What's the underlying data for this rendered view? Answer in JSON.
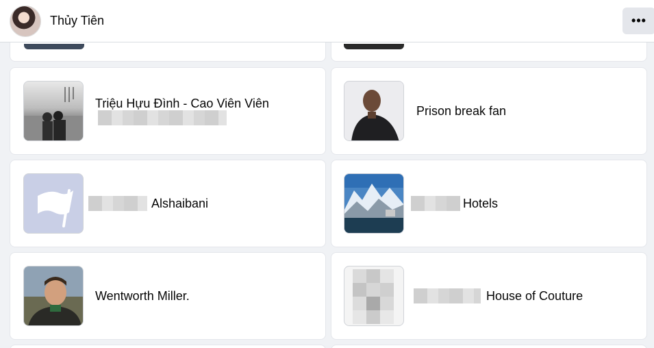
{
  "header": {
    "name": "Thủy Tiên",
    "more_label": "•••"
  },
  "cards": [
    {
      "name": "Triệu Hựu Đình - Cao Viên Viên",
      "thumb": "photo-couple"
    },
    {
      "name": "Prison break fan",
      "thumb": "photo-man-hoodie"
    },
    {
      "name": "Alshaibani",
      "thumb": "page-flag-icon"
    },
    {
      "name": "Hotels",
      "thumb": "photo-mountains"
    },
    {
      "name": "Wentworth Miller.",
      "thumb": "photo-man"
    },
    {
      "name": "House of Couture",
      "thumb": "photo-blurred"
    }
  ],
  "colors": {
    "background": "#f0f2f5",
    "card": "#ffffff",
    "button": "#e4e6eb",
    "flag_bg": "#c9cfe6"
  }
}
